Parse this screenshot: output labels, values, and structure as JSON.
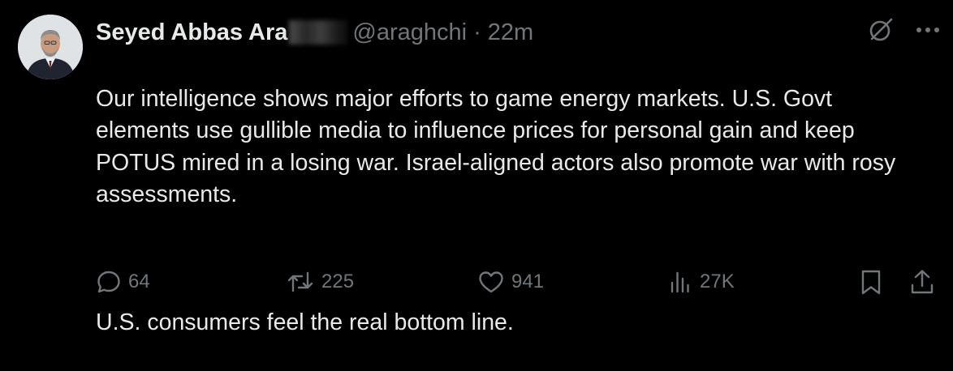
{
  "author": {
    "display_name": "Seyed Abbas Ara",
    "handle": "@araghchi",
    "separator": "·",
    "time": "22m"
  },
  "tweet": {
    "paragraph_1": "Our intelligence shows major efforts to game energy markets. U.S. Govt elements use gullible media to influence prices for personal gain and keep POTUS mired in a losing war. Israel-aligned actors also promote war with rosy assessments.",
    "paragraph_2": "U.S. consumers feel the real bottom line."
  },
  "metrics": {
    "replies": "64",
    "reposts": "225",
    "likes": "941",
    "views": "27K"
  },
  "icons": {
    "top_right": [
      "grok-icon",
      "more-icon"
    ],
    "actions": [
      "reply-icon",
      "repost-icon",
      "like-icon",
      "views-icon",
      "bookmark-icon",
      "share-icon"
    ]
  },
  "colors": {
    "background": "#000000",
    "primary_text": "#e7e9ea",
    "secondary_text": "#71767b"
  }
}
